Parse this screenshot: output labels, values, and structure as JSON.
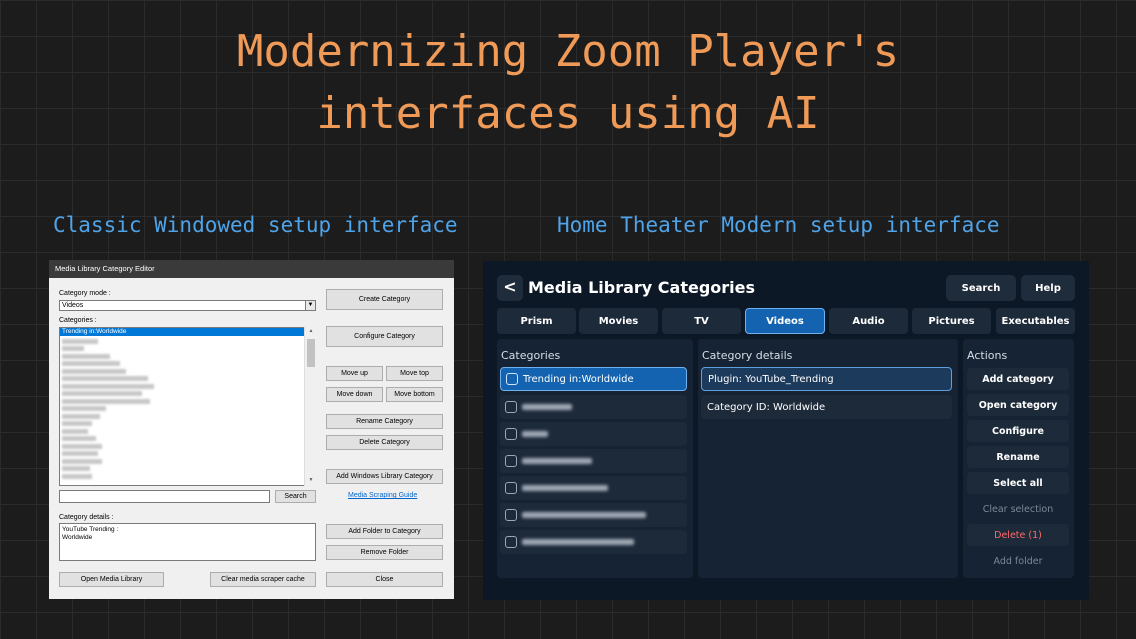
{
  "headline": {
    "line1": "Modernizing Zoom Player's",
    "line2": "interfaces using AI"
  },
  "captions": {
    "classic": "Classic Windowed setup interface",
    "modern": "Home Theater Modern setup interface"
  },
  "classic": {
    "window_title": "Media Library Category Editor",
    "category_mode_label": "Category mode :",
    "category_mode_value": "Videos",
    "categories_label": "Categories :",
    "selected_category": "Trending in:Worldwide",
    "search_button": "Search",
    "scraping_guide_link": "Media Scraping Guide",
    "category_details_label": "Category details :",
    "category_details_lines": [
      "YouTube Trending :",
      "Worldwide"
    ],
    "buttons": {
      "create": "Create Category",
      "configure": "Configure Category",
      "move_up": "Move up",
      "move_top": "Move top",
      "move_down": "Move down",
      "move_bottom": "Move bottom",
      "rename": "Rename Category",
      "delete": "Delete Category",
      "add_windows_library": "Add Windows Library Category",
      "add_folder": "Add Folder to Category",
      "remove_folder": "Remove Folder",
      "open_media_library": "Open Media Library",
      "clear_cache": "Clear media scraper cache",
      "close": "Close"
    }
  },
  "modern": {
    "back_label": "<",
    "title": "Media Library Categories",
    "search_button": "Search",
    "help_button": "Help",
    "tabs": [
      "Prism",
      "Movies",
      "TV",
      "Videos",
      "Audio",
      "Pictures",
      "Executables"
    ],
    "active_tab": "Videos",
    "categories_title": "Categories",
    "categories_selected": "Trending in:Worldwide",
    "details_title": "Category details",
    "details": [
      "Plugin: YouTube_Trending",
      "Category ID: Worldwide"
    ],
    "actions_title": "Actions",
    "actions": [
      "Add category",
      "Open category",
      "Configure",
      "Rename",
      "Select all",
      "Clear selection",
      "Delete (1)",
      "Add folder"
    ],
    "colors": {
      "accent": "#1363b0",
      "danger": "#ff6b6b",
      "panel": "#152334",
      "background": "#0d1826"
    }
  }
}
